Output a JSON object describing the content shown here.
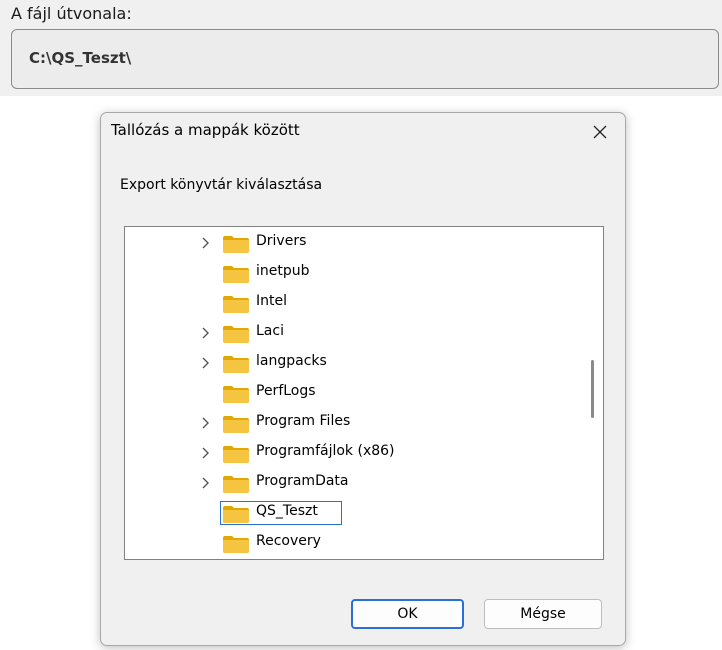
{
  "path_section": {
    "label": "A fájl útvonala:",
    "value": "C:\\QS_Teszt\\"
  },
  "dialog": {
    "title": "Tallózás a mappák között",
    "close_icon": "close-icon",
    "prompt": "Export könyvtár kiválasztása",
    "folders": [
      {
        "label": "Drivers",
        "expandable": true,
        "selected": false
      },
      {
        "label": "inetpub",
        "expandable": false,
        "selected": false
      },
      {
        "label": "Intel",
        "expandable": false,
        "selected": false
      },
      {
        "label": "Laci",
        "expandable": true,
        "selected": false
      },
      {
        "label": "langpacks",
        "expandable": true,
        "selected": false
      },
      {
        "label": "PerfLogs",
        "expandable": false,
        "selected": false
      },
      {
        "label": "Program Files",
        "expandable": true,
        "selected": false
      },
      {
        "label": "Programfájlok (x86)",
        "expandable": true,
        "selected": false
      },
      {
        "label": "ProgramData",
        "expandable": true,
        "selected": false
      },
      {
        "label": "QS_Teszt",
        "expandable": false,
        "selected": true
      },
      {
        "label": "Recovery",
        "expandable": false,
        "selected": false
      }
    ],
    "ok_label": "OK",
    "cancel_label": "Mégse"
  },
  "colors": {
    "accent": "#2a6fd6",
    "folder": "#f5c542",
    "folder_dark": "#e0a800"
  }
}
